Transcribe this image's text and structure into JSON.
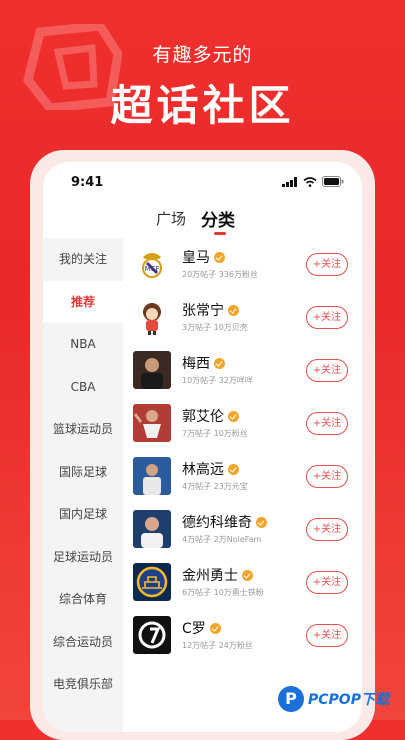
{
  "promo": {
    "tagline": "有趣多元的",
    "headline": "超话社区"
  },
  "status": {
    "time": "9:41"
  },
  "tabs": {
    "square": "广场",
    "category": "分类"
  },
  "sidebar": {
    "items": [
      {
        "label": "我的关注"
      },
      {
        "label": "推荐"
      },
      {
        "label": "NBA"
      },
      {
        "label": "CBA"
      },
      {
        "label": "篮球运动员"
      },
      {
        "label": "国际足球"
      },
      {
        "label": "国内足球"
      },
      {
        "label": "足球运动员"
      },
      {
        "label": "综合体育"
      },
      {
        "label": "综合运动员"
      },
      {
        "label": "电竞俱乐部"
      }
    ]
  },
  "list": {
    "follow_label": "+关注",
    "items": [
      {
        "name": "皇马",
        "stats": "20万帖子 336万粉丝",
        "avatar": "real-madrid-crest-icon"
      },
      {
        "name": "张常宁",
        "stats": "3万帖子 10万贝壳",
        "avatar": "cartoon-character-icon"
      },
      {
        "name": "梅西",
        "stats": "10万帖子 32万咩咩",
        "avatar": "player-photo"
      },
      {
        "name": "郭艾伦",
        "stats": "7万帖子 10万粉丝",
        "avatar": "player-photo"
      },
      {
        "name": "林高远",
        "stats": "4万帖子 23万元宝",
        "avatar": "player-photo"
      },
      {
        "name": "德约科维奇",
        "stats": "4万帖子 2万NoleFam",
        "avatar": "player-photo"
      },
      {
        "name": "金州勇士",
        "stats": "6万帖子 10万勇士铁粉",
        "avatar": "warriors-logo-icon"
      },
      {
        "name": "C罗",
        "stats": "12万帖子 24万粉丝",
        "avatar": "cr7-logo-icon"
      }
    ]
  },
  "watermark": {
    "text": "PCPOP下载",
    "logo": "P"
  },
  "colors": {
    "accent": "#e53935",
    "background": "#ef3330",
    "badge": "#f1a62a"
  }
}
